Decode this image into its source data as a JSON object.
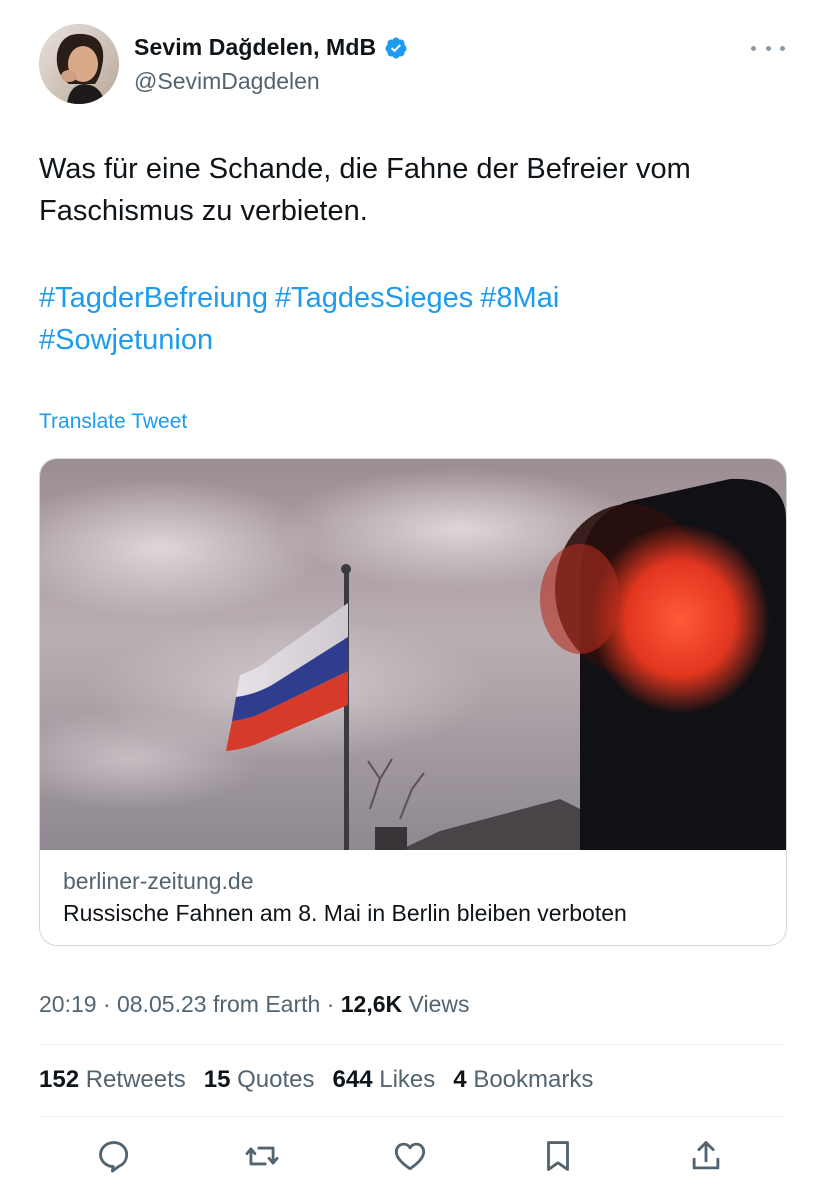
{
  "author": {
    "display_name": "Sevim Dağdelen, MdB",
    "handle": "@SevimDagdelen",
    "verified": true,
    "verified_color": "#1d9bf0"
  },
  "tweet": {
    "text_line1": "Was für eine Schande, die Fahne der Befreier vom",
    "text_line2": "Faschismus zu verbieten.",
    "hashtags": [
      "#TagderBefreiung",
      "#TagdesSieges",
      "#8Mai",
      "#Sowjetunion"
    ],
    "translate_label": "Translate Tweet"
  },
  "link_card": {
    "domain": "berliner-zeitung.de",
    "title": "Russische Fahnen am 8. Mai in Berlin bleiben verboten"
  },
  "meta": {
    "time": "20:19",
    "date": "08.05.23",
    "source": "from Earth",
    "views_count": "12,6K",
    "views_label": "Views"
  },
  "stats": {
    "retweets_count": "152",
    "retweets_label": "Retweets",
    "quotes_count": "15",
    "quotes_label": "Quotes",
    "likes_count": "644",
    "likes_label": "Likes",
    "bookmarks_count": "4",
    "bookmarks_label": "Bookmarks"
  },
  "actions": [
    "reply-icon",
    "retweet-icon",
    "like-icon",
    "bookmark-icon",
    "share-icon"
  ],
  "colors": {
    "link": "#1d9bf0",
    "muted": "#536471",
    "text": "#0f1419"
  }
}
